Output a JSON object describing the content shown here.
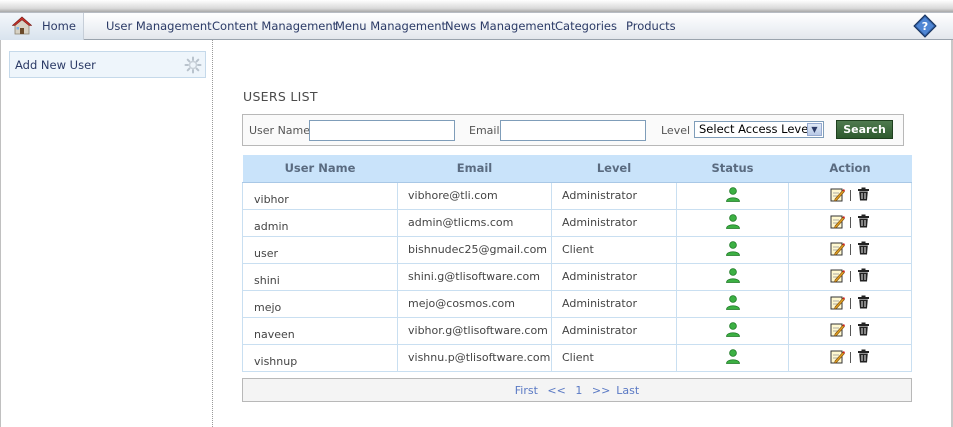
{
  "nav": {
    "items": [
      {
        "label": "Home"
      },
      {
        "label": "User Management"
      },
      {
        "label": "Content Management"
      },
      {
        "label": "Menu Management"
      },
      {
        "label": "News Management"
      },
      {
        "label": "Categories"
      },
      {
        "label": "Products"
      }
    ],
    "icons": [
      "home-icon",
      "help-icon"
    ]
  },
  "sidebar": {
    "add_user_label": "Add New User",
    "icon": "gear-icon"
  },
  "main": {
    "title": "USERS LIST",
    "search": {
      "username_label": "User Name",
      "username_value": "",
      "email_label": "Email",
      "email_value": "",
      "level_label": "Level",
      "level_selected": "Select Access Level",
      "button_label": "Search"
    },
    "table": {
      "headers": [
        "User Name",
        "Email",
        "Level",
        "Status",
        "Action"
      ],
      "rows": [
        {
          "name": "vibhor",
          "email": "vibhore@tli.com",
          "level": "Administrator"
        },
        {
          "name": "admin",
          "email": "admin@tlicms.com",
          "level": "Administrator"
        },
        {
          "name": "user",
          "email": "bishnudec25@gmail.com",
          "level": "Client"
        },
        {
          "name": "shini",
          "email": "shini.g@tlisoftware.com",
          "level": "Administrator"
        },
        {
          "name": "mejo",
          "email": "mejo@cosmos.com",
          "level": "Administrator"
        },
        {
          "name": "naveen",
          "email": "vibhor.g@tlisoftware.com",
          "level": "Administrator"
        },
        {
          "name": "vishnup",
          "email": "vishnu.p@tlisoftware.com",
          "level": "Client"
        }
      ],
      "status_icon": "user-active-icon",
      "action_icons": [
        "edit-icon",
        "delete-icon"
      ]
    },
    "pager": {
      "first": "First",
      "prev": "<<",
      "page": "1",
      "next": ">>",
      "last": "Last"
    }
  },
  "colors": {
    "header_bg": "#c9e3fa",
    "search_button": "#3b6a3b",
    "link": "#5a79c4",
    "status_green": "#3cb043"
  }
}
